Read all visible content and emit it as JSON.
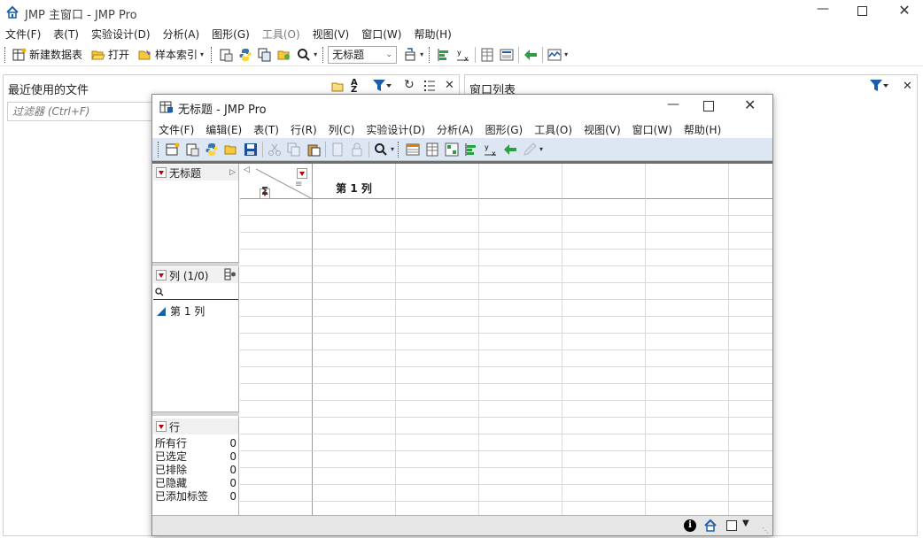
{
  "main": {
    "title": "JMP 主窗口 - JMP Pro",
    "menu": [
      "文件(F)",
      "表(T)",
      "实验设计(D)",
      "分析(A)",
      "图形(G)",
      "工具(O)",
      "视图(V)",
      "窗口(W)",
      "帮助(H)"
    ],
    "toolbar": {
      "new_table": "新建数据表",
      "open": "打开",
      "sample_index": "样本索引",
      "table_select": "无标题"
    },
    "recent_title": "最近使用的文件",
    "filter_placeholder": "过滤器 (Ctrl+F)",
    "window_list_title": "窗口列表"
  },
  "table_window": {
    "title": "无标题 - JMP Pro",
    "menu": [
      "文件(F)",
      "编辑(E)",
      "表(T)",
      "行(R)",
      "列(C)",
      "实验设计(D)",
      "分析(A)",
      "图形(G)",
      "工具(O)",
      "视图(V)",
      "窗口(W)",
      "帮助(H)"
    ],
    "table_panel_name": "无标题",
    "columns_header": "列 (1/0)",
    "column_item": "第 1 列",
    "rows_header": "行",
    "row_stats": [
      {
        "label": "所有行",
        "value": "0"
      },
      {
        "label": "已选定",
        "value": "0"
      },
      {
        "label": "已排除",
        "value": "0"
      },
      {
        "label": "已隐藏",
        "value": "0"
      },
      {
        "label": "已添加标签",
        "value": "0"
      }
    ],
    "grid_header": "第 1 列",
    "sigma": "Σ"
  }
}
